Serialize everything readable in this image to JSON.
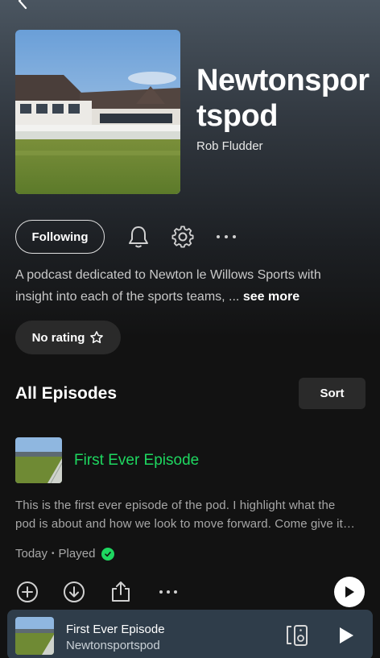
{
  "podcast": {
    "title": "Newtonsportspod",
    "author": "Rob Fludder",
    "follow_label": "Following",
    "description": "A podcast dedicated to Newton le Willows Sports with insight into each of the sports teams, ...",
    "see_more_label": "see more",
    "rating_label": "No rating"
  },
  "episodes_section": {
    "title": "All Episodes",
    "sort_label": "Sort"
  },
  "episode": {
    "title": "First Ever Episode",
    "description": "This is the first ever episode of the pod. I highlight what the pod is about and how we look to move forward. Come give it a listen.",
    "date": "Today",
    "separator": "•",
    "status": "Played"
  },
  "now_playing": {
    "title": "First Ever Episode",
    "show": "Newtonsportspod"
  },
  "icons": {
    "back": "chevron-left-icon",
    "bell": "bell-icon",
    "settings": "gear-icon",
    "more": "more-horizontal-icon",
    "star": "star-icon",
    "add": "plus-circle-icon",
    "download": "download-icon",
    "share": "share-icon",
    "play": "play-icon",
    "devices": "devices-icon",
    "check": "check-icon"
  },
  "colors": {
    "accent": "#1ed760",
    "background": "#121212",
    "mini_player": "#2f3d4a"
  }
}
